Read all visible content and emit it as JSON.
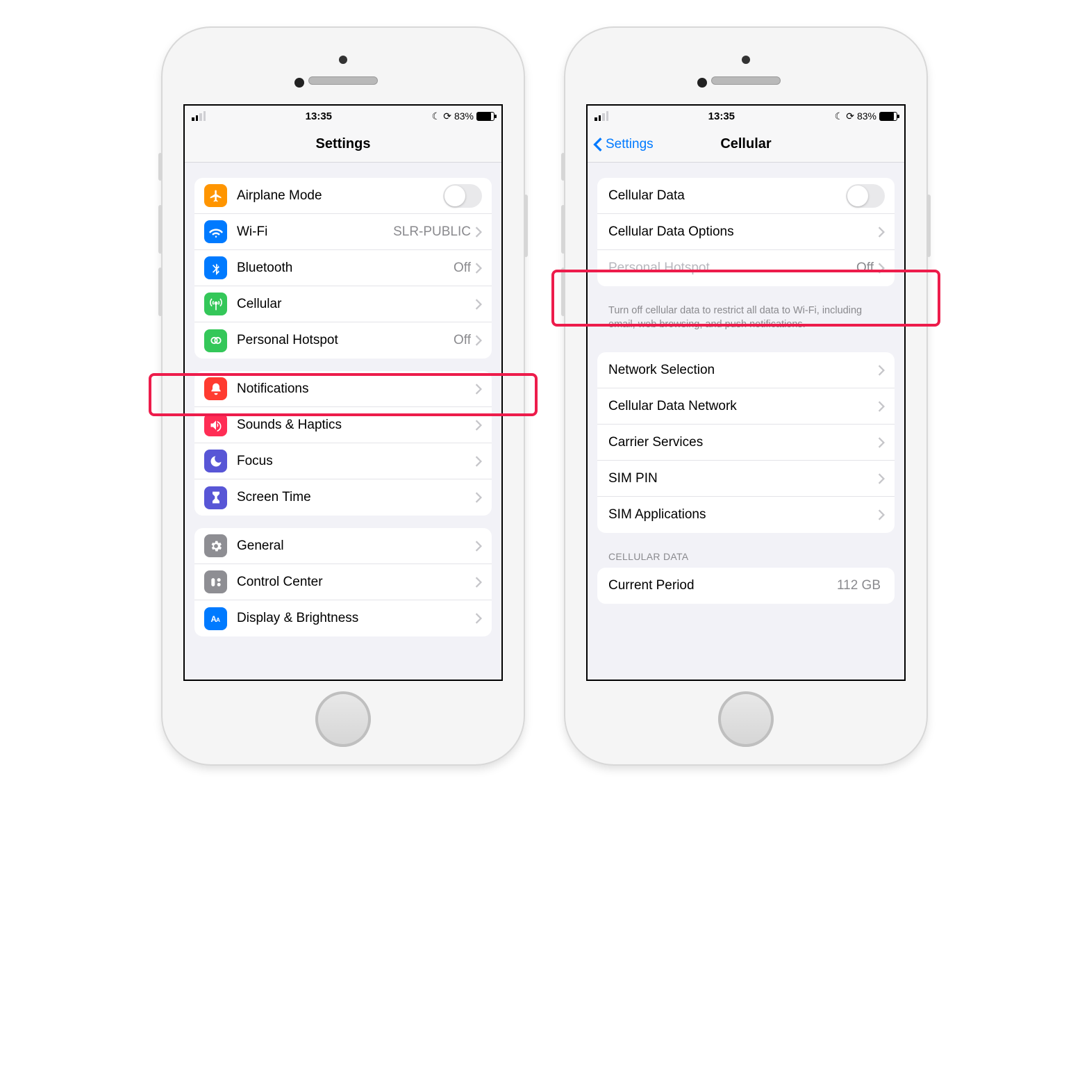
{
  "status": {
    "time": "13:35",
    "batteryText": "83%"
  },
  "left": {
    "navTitle": "Settings",
    "group1": [
      {
        "name": "airplane-mode",
        "label": "Airplane Mode",
        "right": "toggle"
      },
      {
        "name": "wifi",
        "label": "Wi-Fi",
        "value": "SLR-PUBLIC",
        "right": "chevron"
      },
      {
        "name": "bluetooth",
        "label": "Bluetooth",
        "value": "Off",
        "right": "chevron"
      },
      {
        "name": "cellular",
        "label": "Cellular",
        "right": "chevron"
      },
      {
        "name": "personal-hotspot",
        "label": "Personal Hotspot",
        "value": "Off",
        "right": "chevron"
      }
    ],
    "group2": [
      {
        "name": "notifications",
        "label": "Notifications",
        "right": "chevron"
      },
      {
        "name": "sounds-haptics",
        "label": "Sounds & Haptics",
        "right": "chevron"
      },
      {
        "name": "focus",
        "label": "Focus",
        "right": "chevron"
      },
      {
        "name": "screen-time",
        "label": "Screen Time",
        "right": "chevron"
      }
    ],
    "group3": [
      {
        "name": "general",
        "label": "General",
        "right": "chevron"
      },
      {
        "name": "control-center",
        "label": "Control Center",
        "right": "chevron"
      },
      {
        "name": "display-brightness",
        "label": "Display & Brightness",
        "right": "chevron"
      }
    ]
  },
  "right": {
    "backLabel": "Settings",
    "navTitle": "Cellular",
    "group1": [
      {
        "name": "cellular-data",
        "label": "Cellular Data",
        "right": "toggle"
      },
      {
        "name": "cellular-data-options",
        "label": "Cellular Data Options",
        "right": "chevron"
      },
      {
        "name": "personal-hotspot",
        "label": "Personal Hotspot",
        "value": "Off",
        "right": "chevron",
        "disabled": true
      }
    ],
    "footer": "Turn off cellular data to restrict all data to Wi-Fi, including email, web browsing, and push notifications.",
    "group2": [
      {
        "name": "network-selection",
        "label": "Network Selection",
        "right": "chevron"
      },
      {
        "name": "cellular-data-network",
        "label": "Cellular Data Network",
        "right": "chevron"
      },
      {
        "name": "carrier-services",
        "label": "Carrier Services",
        "right": "chevron"
      },
      {
        "name": "sim-pin",
        "label": "SIM PIN",
        "right": "chevron"
      },
      {
        "name": "sim-applications",
        "label": "SIM Applications",
        "right": "chevron"
      }
    ],
    "dataHeader": "CELLULAR DATA",
    "group3": [
      {
        "name": "current-period",
        "label": "Current Period",
        "value": "112 GB"
      }
    ]
  }
}
